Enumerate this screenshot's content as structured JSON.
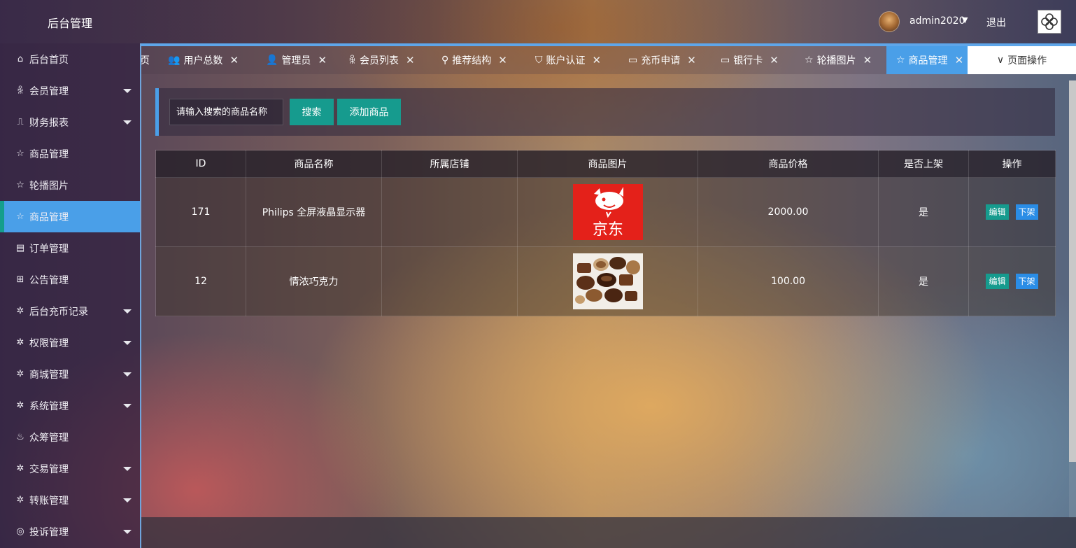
{
  "header": {
    "brand": "后台管理",
    "username": "admin2020",
    "logout": "退出"
  },
  "sidebar": {
    "items": [
      {
        "label": "后台首页",
        "icon": "home-icon",
        "glyph": "⌂",
        "arrow": false,
        "active": false
      },
      {
        "label": "会员管理",
        "icon": "user-icon",
        "glyph": "ꆜ",
        "arrow": true,
        "active": false
      },
      {
        "label": "财务报表",
        "icon": "chart-icon",
        "glyph": "⎍",
        "arrow": true,
        "active": false
      },
      {
        "label": "商品管理",
        "icon": "star-icon",
        "glyph": "☆",
        "arrow": false,
        "active": false
      },
      {
        "label": "轮播图片",
        "icon": "star-icon",
        "glyph": "☆",
        "arrow": false,
        "active": false
      },
      {
        "label": "商品管理",
        "icon": "star-icon",
        "glyph": "☆",
        "arrow": false,
        "active": true
      },
      {
        "label": "订单管理",
        "icon": "clipboard-icon",
        "glyph": "▤",
        "arrow": false,
        "active": false
      },
      {
        "label": "公告管理",
        "icon": "book-icon",
        "glyph": "⊞",
        "arrow": false,
        "active": false
      },
      {
        "label": "后台充币记录",
        "icon": "gear-icon",
        "glyph": "✲",
        "arrow": true,
        "active": false
      },
      {
        "label": "权限管理",
        "icon": "gear-icon",
        "glyph": "✲",
        "arrow": true,
        "active": false
      },
      {
        "label": "商城管理",
        "icon": "gear-icon",
        "glyph": "✲",
        "arrow": true,
        "active": false
      },
      {
        "label": "系统管理",
        "icon": "gear-icon",
        "glyph": "✲",
        "arrow": true,
        "active": false
      },
      {
        "label": "众筹管理",
        "icon": "drops-icon",
        "glyph": "♨",
        "arrow": false,
        "active": false
      },
      {
        "label": "交易管理",
        "icon": "gear-icon",
        "glyph": "✲",
        "arrow": true,
        "active": false
      },
      {
        "label": "转账管理",
        "icon": "gear-icon",
        "glyph": "✲",
        "arrow": true,
        "active": false
      },
      {
        "label": "投诉管理",
        "icon": "target-icon",
        "glyph": "◎",
        "arrow": true,
        "active": false
      }
    ]
  },
  "tabs": {
    "partial": "页",
    "items": [
      {
        "label": "用户总数",
        "icon": "users-icon",
        "glyph": "👥"
      },
      {
        "label": "管理员",
        "icon": "person-icon",
        "glyph": "👤"
      },
      {
        "label": "会员列表",
        "icon": "user-icon",
        "glyph": "ꆜ"
      },
      {
        "label": "推荐结构",
        "icon": "org-icon",
        "glyph": "⚲"
      },
      {
        "label": "账户认证",
        "icon": "shield-icon",
        "glyph": "⛉"
      },
      {
        "label": "充币申请",
        "icon": "document-icon",
        "glyph": "▭"
      },
      {
        "label": "银行卡",
        "icon": "card-icon",
        "glyph": "▭"
      },
      {
        "label": "轮播图片",
        "icon": "star-icon",
        "glyph": "☆"
      },
      {
        "label": "商品管理",
        "icon": "star-icon",
        "glyph": "☆"
      }
    ],
    "close": "✕",
    "page_ops": "页面操作"
  },
  "search": {
    "placeholder": "请输入搜索的商品名称",
    "search_btn": "搜索",
    "add_btn": "添加商品"
  },
  "table": {
    "headers": [
      "ID",
      "商品名称",
      "所属店铺",
      "商品图片",
      "商品价格",
      "是否上架",
      "操作"
    ],
    "rows": [
      {
        "id": "171",
        "name": "Philips 全屏液晶显示器",
        "shop": "",
        "image": "京东",
        "price": "2000.00",
        "listed": "是",
        "edit": "编辑",
        "delist": "下架"
      },
      {
        "id": "12",
        "name": "情浓巧克力",
        "shop": "",
        "image": "chocolate",
        "price": "100.00",
        "listed": "是",
        "edit": "编辑",
        "delist": "下架"
      }
    ]
  },
  "colors": {
    "accent_blue": "#4a9fe8",
    "accent_green": "#169b8e",
    "jd_red": "#e4211a"
  }
}
